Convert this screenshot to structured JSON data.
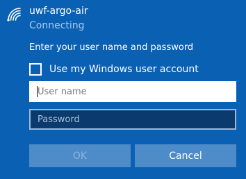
{
  "network": {
    "icon": "wifi-icon",
    "name": "uwf-argo-air",
    "status": "Connecting"
  },
  "auth": {
    "prompt": "Enter your user name and password",
    "use_windows_account_label": "Use my Windows user account",
    "use_windows_account_checked": false,
    "username_placeholder": "User name",
    "username_value": "",
    "password_placeholder": "Password",
    "password_value": ""
  },
  "buttons": {
    "ok_label": "OK",
    "ok_enabled": false,
    "cancel_label": "Cancel"
  },
  "colors": {
    "background": "#0a61b3",
    "button": "#4d8bc9",
    "password_field": "#0a3a6e"
  }
}
